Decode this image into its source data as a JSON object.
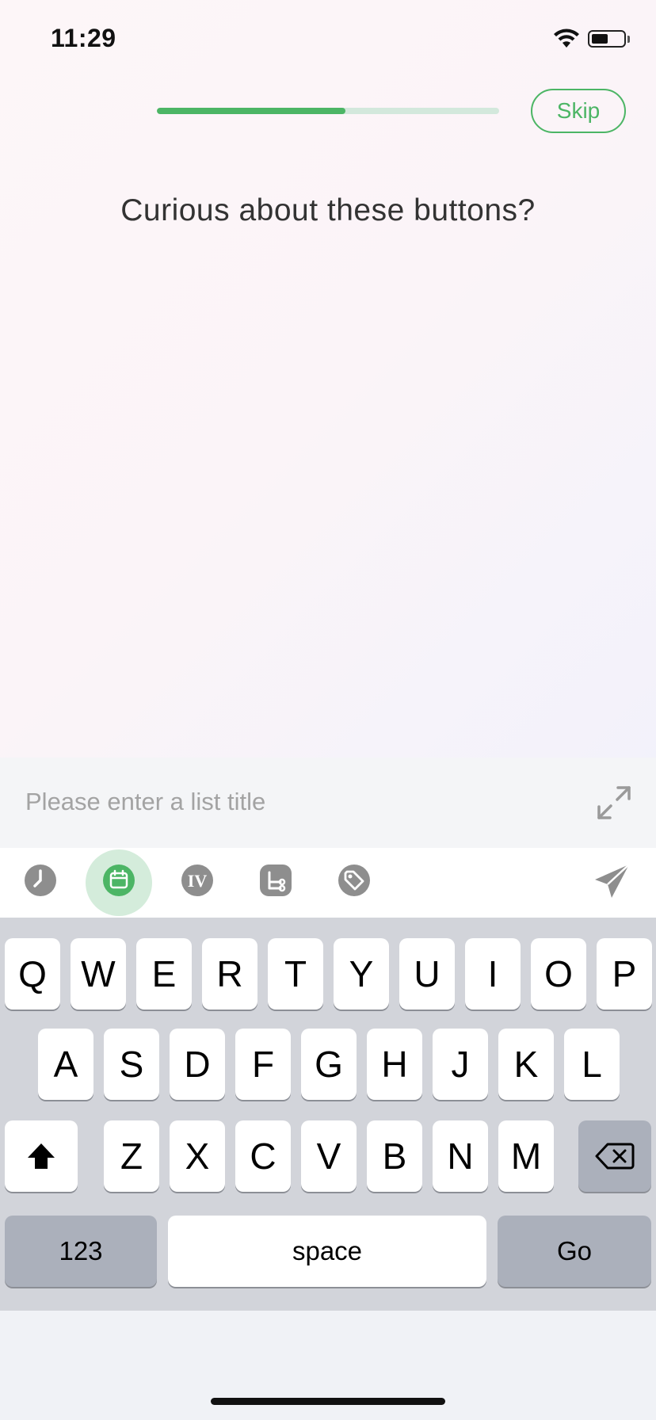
{
  "status_bar": {
    "time": "11:29",
    "battery_level": 0.6
  },
  "onboarding": {
    "progress": 0.55,
    "skip_label": "Skip",
    "headline": "Curious about these buttons?"
  },
  "input": {
    "placeholder": "Please enter a list title"
  },
  "toolbar": {
    "icons": [
      "clock-icon",
      "calendar-icon",
      "priority-icon",
      "list-icon",
      "tag-icon"
    ],
    "active": "calendar-icon",
    "iv_text": "IV",
    "accent_color": "#4cb565"
  },
  "keyboard": {
    "row1": [
      "Q",
      "W",
      "E",
      "R",
      "T",
      "Y",
      "U",
      "I",
      "O",
      "P"
    ],
    "row2": [
      "A",
      "S",
      "D",
      "F",
      "G",
      "H",
      "J",
      "K",
      "L"
    ],
    "row3": [
      "Z",
      "X",
      "C",
      "V",
      "B",
      "N",
      "M"
    ],
    "numbers_label": "123",
    "space_label": "space",
    "go_label": "Go"
  }
}
